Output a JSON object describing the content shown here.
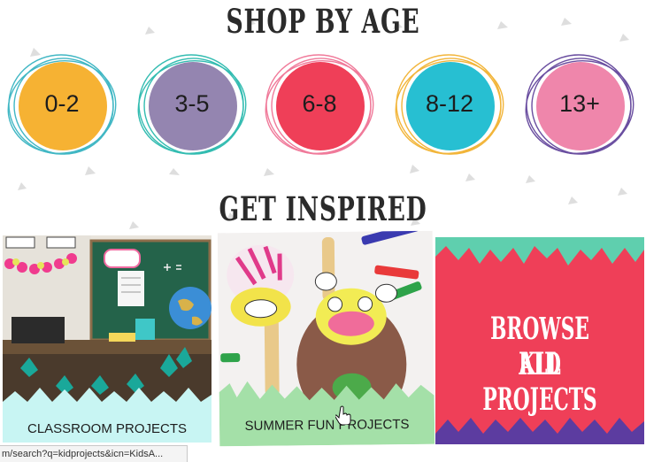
{
  "headings": {
    "shop_by_age": "SHOP BY AGE",
    "get_inspired": "GET INSPIRED"
  },
  "age_groups": [
    {
      "label": "0-2",
      "fill": "#f6b233",
      "ring": "#41b7c4"
    },
    {
      "label": "3-5",
      "fill": "#9485b0",
      "ring": "#33bcb1"
    },
    {
      "label": "6-8",
      "fill": "#ef3f58",
      "ring": "#f07a9a"
    },
    {
      "label": "8-12",
      "fill": "#27bfd2",
      "ring": "#f2b53a"
    },
    {
      "label": "13+",
      "fill": "#ef86ab",
      "ring": "#6a4ea0"
    }
  ],
  "inspiration_cards": [
    {
      "label": "CLASSROOM PROJECTS",
      "band_color": "#c8f5f3"
    },
    {
      "label": "SUMMER FUN PROJECTS",
      "band_color": "#a4e0a8"
    },
    {
      "line1": "BROWSE ALL",
      "line2": "KID PROJECTS",
      "bg": "#ef3f58",
      "zigzag": "#5fcfae",
      "bottom_zigzag": "#5c3ca0"
    }
  ],
  "classroom_scene": {
    "whiteboard_text": "Hello Students!",
    "board_math": "4x5 ="
  },
  "status_bar": {
    "url": "m/search?q=kidprojects&icn=KidsA..."
  },
  "colors": {
    "confetti": "#dcdcdc",
    "heading": "#2b2b2b"
  }
}
